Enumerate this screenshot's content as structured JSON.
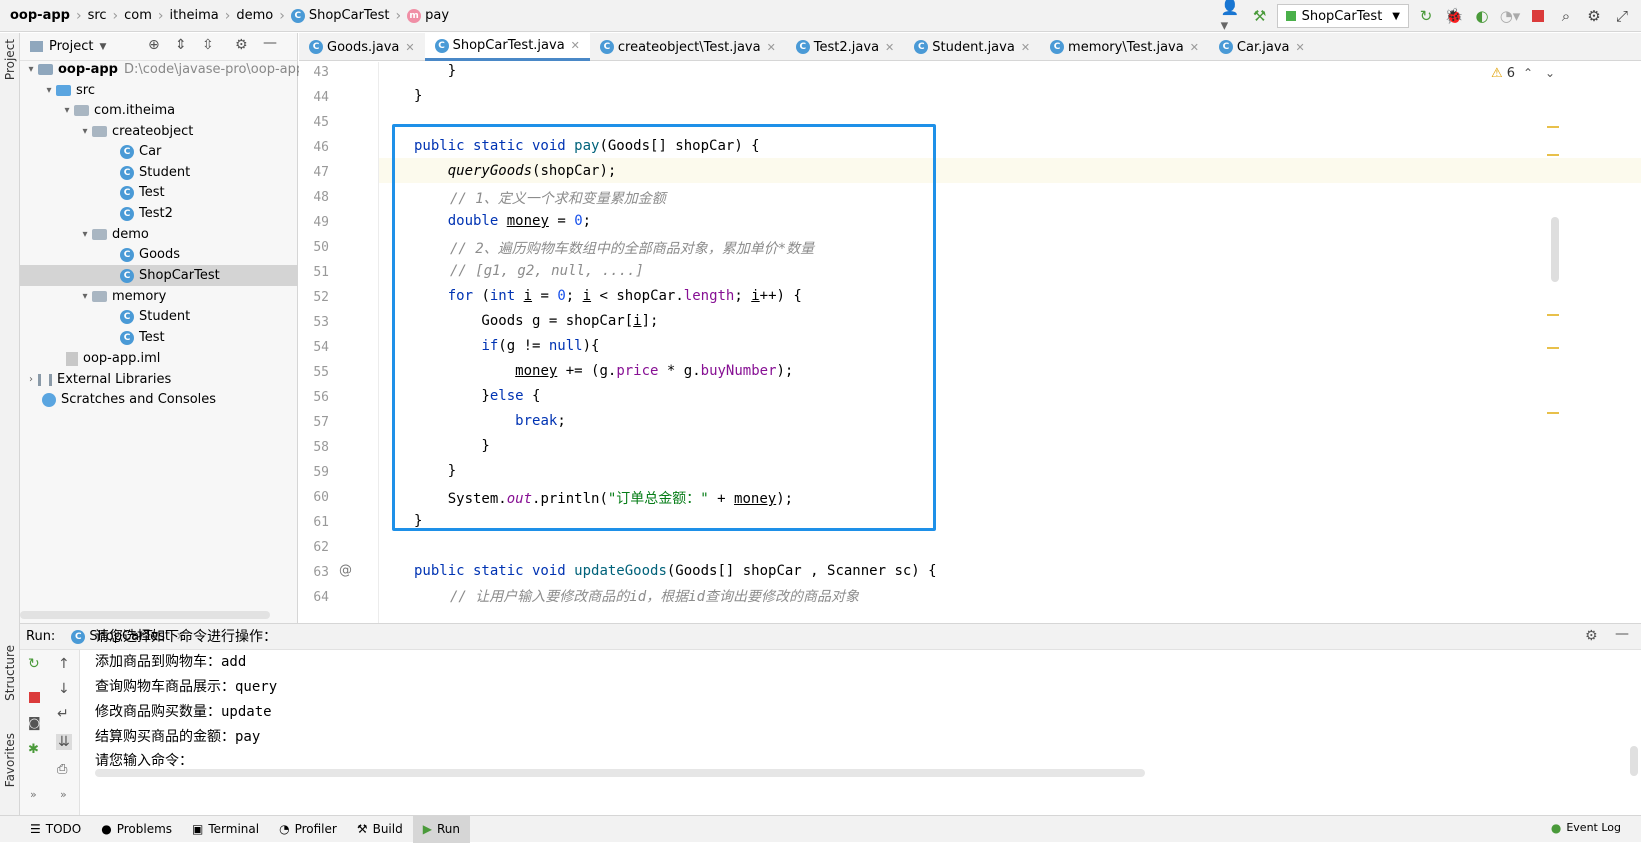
{
  "breadcrumb": {
    "project": "oop-app",
    "items": [
      "src",
      "com",
      "itheima",
      "demo",
      "ShopCarTest",
      "pay"
    ]
  },
  "toolbar": {
    "run_config": "ShopCarTest",
    "warnings": "6"
  },
  "project_panel": {
    "title": "Project",
    "root_name": "oop-app",
    "root_path": "D:\\code\\javase-pro\\oop-app",
    "tree": {
      "src": "src",
      "pkg": "com.itheima",
      "createobject": "createobject",
      "car": "Car",
      "student": "Student",
      "test": "Test",
      "test2": "Test2",
      "demo": "demo",
      "goods": "Goods",
      "shopcartest": "ShopCarTest",
      "memory": "memory",
      "mem_student": "Student",
      "mem_test": "Test",
      "iml": "oop-app.iml",
      "ext_libs": "External Libraries",
      "scratches": "Scratches and Consoles"
    }
  },
  "side_strip": {
    "project": "Project",
    "structure": "Structure",
    "favorites": "Favorites"
  },
  "tabs": [
    {
      "label": "Goods.java"
    },
    {
      "label": "ShopCarTest.java"
    },
    {
      "label": "createobject\\Test.java"
    },
    {
      "label": "Test2.java"
    },
    {
      "label": "Student.java"
    },
    {
      "label": "memory\\Test.java"
    },
    {
      "label": "Car.java"
    }
  ],
  "editor": {
    "line_numbers": [
      "43",
      "44",
      "45",
      "46",
      "47",
      "48",
      "49",
      "50",
      "51",
      "52",
      "53",
      "54",
      "55",
      "56",
      "57",
      "58",
      "59",
      "60",
      "61",
      "62",
      "63",
      "64"
    ],
    "comment1": "// 1、定义一个求和变量累加金额",
    "comment2": "// 2、遍历购物车数组中的全部商品对象，累加单价*数量",
    "comment3": "// [g1, g2, null, ....]",
    "comment4": "// 让用户输入要修改商品的id，根据id查询出要修改的商品对象",
    "print_string": "\"订单总金额：\""
  },
  "run_panel": {
    "label": "Run:",
    "tab": "ShopCarTest",
    "console": [
      "请您选择如下命令进行操作：",
      "添加商品到购物车：add",
      "查询购物车商品展示：query",
      "修改商品购买数量：update",
      "结算购买商品的金额：pay",
      "请您输入命令："
    ]
  },
  "bottom_tools": {
    "todo": "TODO",
    "problems": "Problems",
    "terminal": "Terminal",
    "profiler": "Profiler",
    "build": "Build",
    "run": "Run",
    "event_log": "Event Log"
  }
}
